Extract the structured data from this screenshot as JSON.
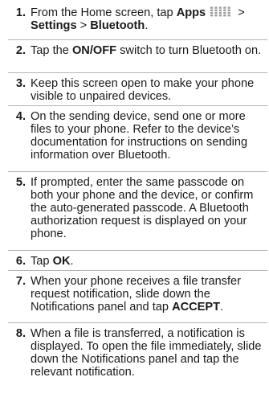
{
  "steps": [
    {
      "num": "1.",
      "parts": [
        {
          "t": "From the Home screen, tap "
        },
        {
          "t": "Apps",
          "b": true
        },
        {
          "icon": "apps-grid-icon"
        },
        {
          "t": " > "
        },
        {
          "t": "Settings",
          "b": true
        },
        {
          "t": " > "
        },
        {
          "t": "Bluetooth",
          "b": true
        },
        {
          "t": "."
        }
      ]
    },
    {
      "num": "2.",
      "parts": [
        {
          "t": "Tap the "
        },
        {
          "t": "ON/OFF",
          "b": true
        },
        {
          "t": " switch to turn Bluetooth on."
        }
      ]
    },
    {
      "num": "3.",
      "parts": [
        {
          "t": "Keep this screen open to make your phone visible to unpaired devices."
        }
      ]
    },
    {
      "num": "4.",
      "parts": [
        {
          "t": "On the sending device, send one or more files to your phone. Refer to the device’s documentation for instructions on sending information over Bluetooth."
        }
      ]
    },
    {
      "num": "5.",
      "parts": [
        {
          "t": "If prompted, enter the same passcode on both your phone and the device, or confirm the auto-generated passcode. A Bluetooth authorization request is displayed on your phone."
        }
      ]
    },
    {
      "num": "6.",
      "parts": [
        {
          "t": "Tap "
        },
        {
          "t": "OK",
          "b": true
        },
        {
          "t": "."
        }
      ]
    },
    {
      "num": "7.",
      "parts": [
        {
          "t": "When your phone receives a file transfer request notification, slide down the Notifications panel and tap "
        },
        {
          "t": "ACCEPT",
          "b": true
        },
        {
          "t": "."
        }
      ]
    },
    {
      "num": "8.",
      "parts": [
        {
          "t": "When a file is transferred, a notification is displayed. To open the file immediately, slide down the Notifications panel and tap the relevant notification."
        }
      ]
    }
  ]
}
